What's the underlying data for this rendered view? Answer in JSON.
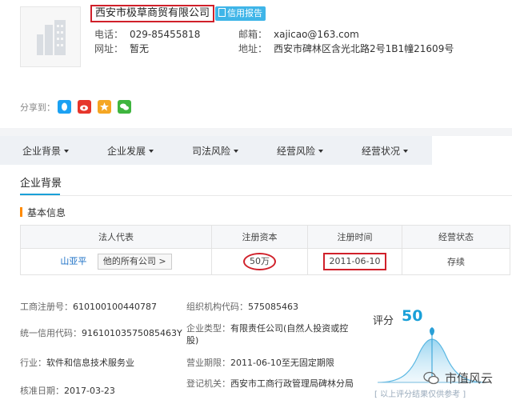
{
  "company": {
    "name": "西安市极草商贸有限公司",
    "credit_report": "信用报告",
    "phone_label": "电话：",
    "phone": "029-85455818",
    "email_label": "邮箱：",
    "email": "xajicao@163.com",
    "website_label": "网址：",
    "website": "暂无",
    "address_label": "地址：",
    "address": "西安市碑林区含光北路2号1B1幢21609号"
  },
  "share": {
    "label": "分享到：",
    "colors": [
      "#1ba1f3",
      "#e6352b",
      "#f5a623",
      "#3fb53f"
    ]
  },
  "tabs": [
    {
      "label": "企业背景"
    },
    {
      "label": "企业发展"
    },
    {
      "label": "司法风险"
    },
    {
      "label": "经营风险"
    },
    {
      "label": "经营状况"
    }
  ],
  "section": {
    "tab": "企业背景",
    "basic_title": "基本信息"
  },
  "registration_table": {
    "headers": [
      "法人代表",
      "注册资本",
      "注册时间",
      "经营状态"
    ],
    "legal_rep": "山亚平",
    "all_companies": "他的所有公司 >",
    "capital": "50万",
    "reg_date": "2011-06-10",
    "status": "存续"
  },
  "details": {
    "reg_no_label": "工商注册号：",
    "reg_no": "610100100440787",
    "org_code_label": "组织机构代码：",
    "org_code": "575085463",
    "credit_code_label": "统一信用代码：",
    "credit_code": "91610103575085463Y",
    "company_type_label": "企业类型：",
    "company_type": "有限责任公司(自然人投资或控股)",
    "industry_label": "行业：",
    "industry": "软件和信息技术服务业",
    "term_label": "营业期限：",
    "term": "2011-06-10至无固定期限",
    "approval_label": "核准日期：",
    "approval": "2017-03-23",
    "authority_label": "登记机关：",
    "authority": "西安市工商行政管理局碑林分局"
  },
  "score": {
    "label": "评分",
    "value": "50",
    "note": "[ 以上评分结果仅供参考 ]",
    "accent": "#1aa0d8"
  },
  "watermark": "市值风云"
}
